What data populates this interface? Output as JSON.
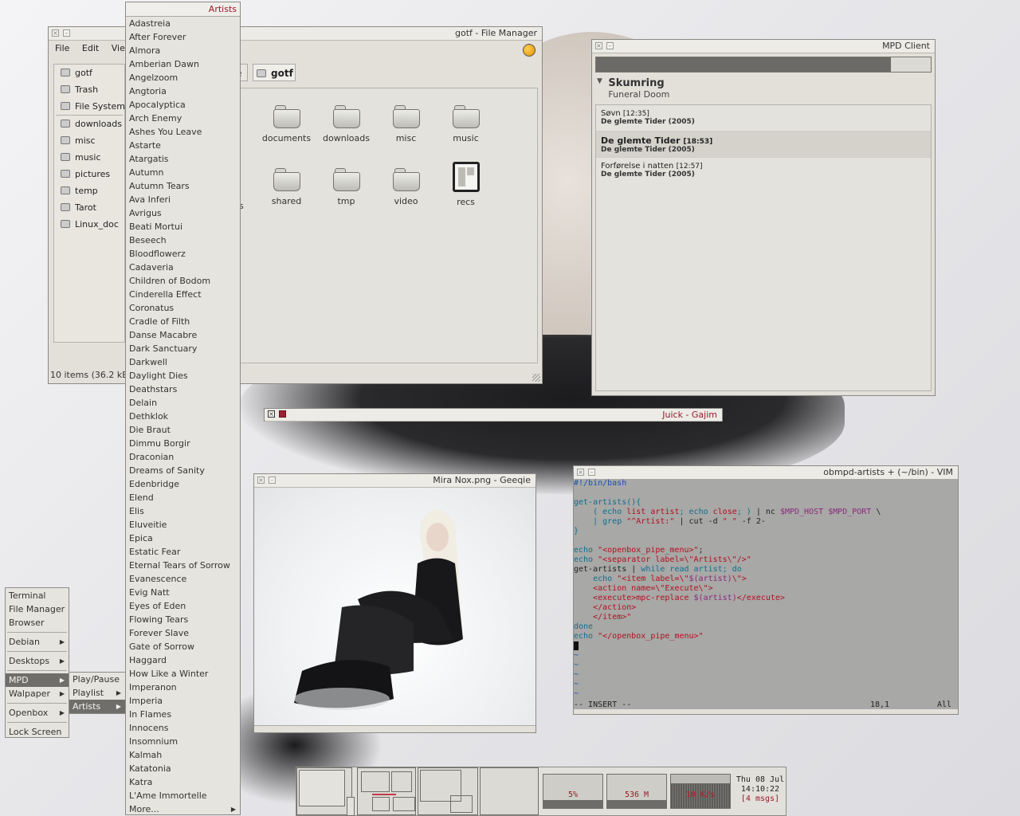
{
  "file_manager": {
    "title": "gotf - File Manager",
    "menu": [
      "File",
      "Edit",
      "View"
    ],
    "path_prev": "e",
    "path_current": "gotf",
    "sidebar": [
      "gotf",
      "Trash",
      "File System",
      "downloads",
      "misc",
      "music",
      "pictures",
      "temp",
      "Tarot",
      "Linux_doc"
    ],
    "icons": [
      "documents",
      "downloads",
      "misc",
      "music",
      "shared",
      "tmp",
      "video",
      "recs"
    ],
    "partial_label": "s",
    "status": "10 items (36.2 kB"
  },
  "artists_menu": {
    "header": "Artists",
    "items": [
      "Adastreia",
      "After Forever",
      "Almora",
      "Amberian Dawn",
      "Angelzoom",
      "Angtoria",
      "Apocalyptica",
      "Arch Enemy",
      "Ashes You Leave",
      "Astarte",
      "Atargatis",
      "Autumn",
      "Autumn Tears",
      "Ava Inferi",
      "Avrigus",
      "Beati Mortui",
      "Beseech",
      "Bloodflowerz",
      "Cadaveria",
      "Children of Bodom",
      "Cinderella Effect",
      "Coronatus",
      "Cradle of Filth",
      "Danse Macabre",
      "Dark Sanctuary",
      "Darkwell",
      "Daylight Dies",
      "Deathstars",
      "Delain",
      "Dethklok",
      "Die Braut",
      "Dimmu Borgir",
      "Draconian",
      "Dreams of Sanity",
      "Edenbridge",
      "Elend",
      "Elis",
      "Eluveitie",
      "Epica",
      "Estatic Fear",
      "Eternal Tears of Sorrow",
      "Evanescence",
      "Evig Natt",
      "Eyes of Eden",
      "Flowing Tears",
      "Forever Slave",
      "Gate of Sorrow",
      "Haggard",
      "How Like a Winter",
      "Imperanon",
      "Imperia",
      "In Flames",
      "Innocens",
      "Insomnium",
      "Kalmah",
      "Katatonia",
      "Katra",
      "L'Ame Immortelle"
    ],
    "more": "More..."
  },
  "mpd": {
    "title": "MPD Client",
    "progress": 0.88,
    "artist": "Skumring",
    "genre": "Funeral Doom",
    "songs": [
      {
        "title": "Søvn",
        "time": "[12:35]",
        "album": "De glemte Tider (2005)"
      },
      {
        "title": "De glemte Tider",
        "time": "[18:53]",
        "album": "De glemte Tider (2005)"
      },
      {
        "title": "Forførelse i natten",
        "time": "[12:57]",
        "album": "De glemte Tider (2005)"
      }
    ]
  },
  "gajim": {
    "title": "Juick - Gajim"
  },
  "geeqie": {
    "title": "Mira Nox.png - Geeqie"
  },
  "vim": {
    "title": "obmpd-artists + (~/bin) - VIM",
    "mode": "-- INSERT --",
    "position": "18,1",
    "scroll": "All"
  },
  "root_menu": {
    "items": [
      "Terminal",
      "File Manager",
      "Browser",
      "Debian",
      "Desktops",
      "MPD",
      "Walpaper",
      "Openbox",
      "Lock Screen"
    ],
    "mpd_sub": [
      "Play/Pause",
      "Playlist",
      "Artists"
    ]
  },
  "panel": {
    "cpu": "5%",
    "mem": "536 M",
    "net": "10 K/s",
    "date": "Thu 08 Jul",
    "time": "14:10:22",
    "msgs": "[4 msgs]",
    "cpu_level": 0.25,
    "mem_level": 0.25,
    "net_level": 0.75
  }
}
